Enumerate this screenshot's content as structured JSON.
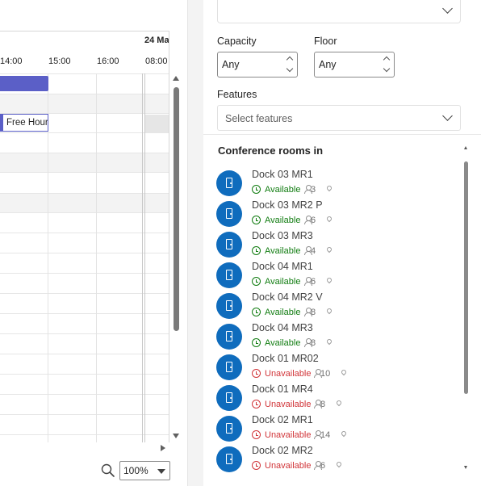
{
  "schedule": {
    "date_header": "24 Ma",
    "times": [
      "14:00",
      "15:00",
      "16:00",
      "08:00"
    ],
    "free_slot_label": "Free Hour"
  },
  "zoom": {
    "value": "100%"
  },
  "filters": {
    "capacity_label": "Capacity",
    "capacity_value": "Any",
    "floor_label": "Floor",
    "floor_value": "Any",
    "features_label": "Features",
    "features_placeholder": "Select features"
  },
  "rooms_section": {
    "title": "Conference rooms in",
    "rooms": [
      {
        "name": "Dock 03 MR1",
        "status": "Available",
        "capacity": "3"
      },
      {
        "name": "Dock 03 MR2 P",
        "status": "Available",
        "capacity": "6"
      },
      {
        "name": "Dock 03 MR3",
        "status": "Available",
        "capacity": "4"
      },
      {
        "name": "Dock 04 MR1",
        "status": "Available",
        "capacity": "6"
      },
      {
        "name": "Dock 04 MR2 V",
        "status": "Available",
        "capacity": "8"
      },
      {
        "name": "Dock 04 MR3",
        "status": "Available",
        "capacity": "8"
      },
      {
        "name": "Dock 01 MR02",
        "status": "Unavailable",
        "capacity": "10"
      },
      {
        "name": "Dock 01 MR4",
        "status": "Unavailable",
        "capacity": "8"
      },
      {
        "name": "Dock 02 MR1",
        "status": "Unavailable",
        "capacity": "14"
      },
      {
        "name": "Dock 02 MR2",
        "status": "Unavailable",
        "capacity": "6"
      }
    ]
  },
  "colors": {
    "accent": "#5b5fc7",
    "room_avatar": "#0f6cbd",
    "available": "#107c10",
    "unavailable": "#d13438"
  },
  "icons": [
    "zoom-search-icon",
    "chevron-down-icon",
    "room-door-icon",
    "clock-icon",
    "person-icon",
    "location-pin-icon"
  ]
}
